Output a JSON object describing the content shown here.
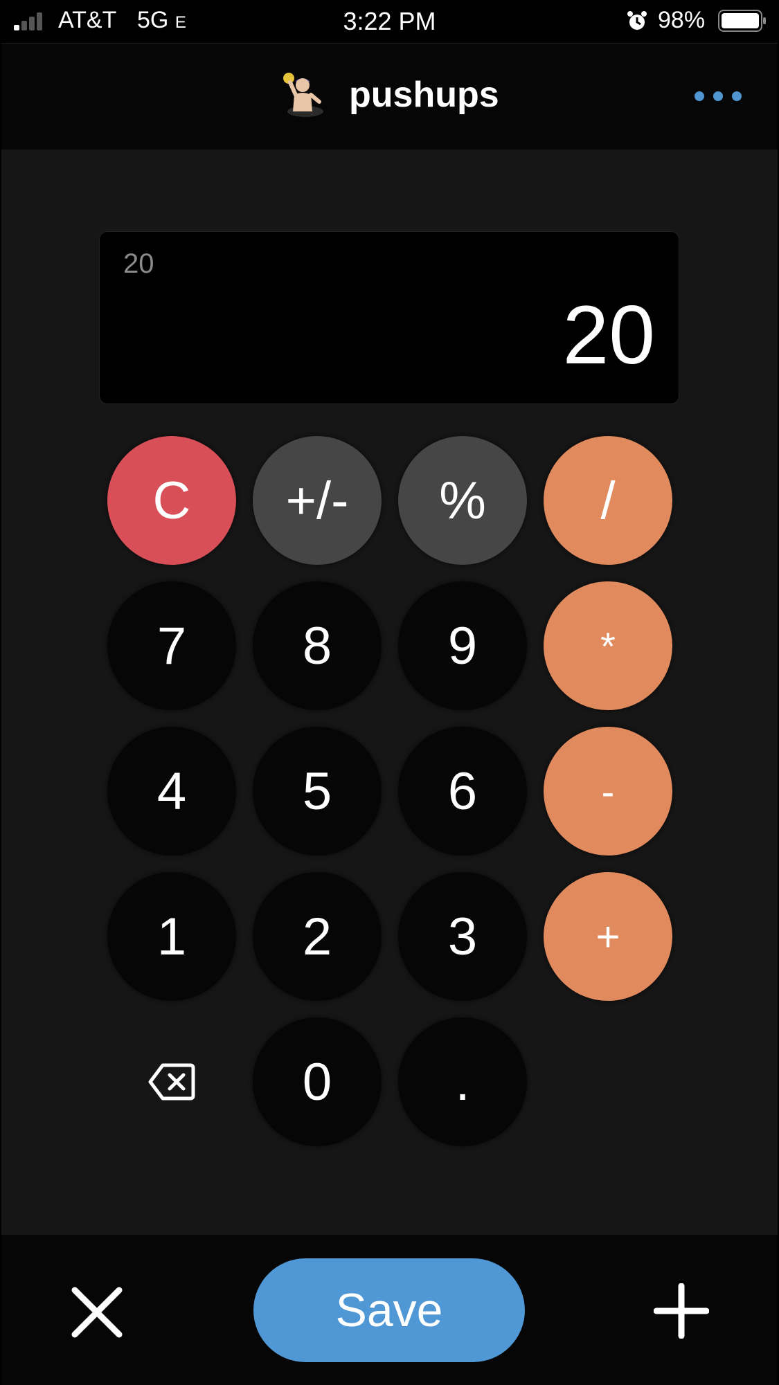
{
  "status_bar": {
    "carrier": "AT&T",
    "network": "5G",
    "network_suffix": "E",
    "time": "3:22 PM",
    "battery": "98%"
  },
  "header": {
    "title": "pushups",
    "avatar_icon": "water-polo-icon",
    "menu_icon": "more-horizontal-icon",
    "accent_color": "#4f96d3"
  },
  "display": {
    "expression": "20",
    "result": "20"
  },
  "keypad": {
    "clear": "C",
    "sign": "+/-",
    "percent": "%",
    "divide": "/",
    "seven": "7",
    "eight": "8",
    "nine": "9",
    "multiply": "*",
    "four": "4",
    "five": "5",
    "six": "6",
    "subtract": "-",
    "one": "1",
    "two": "2",
    "three": "3",
    "add": "+",
    "backspace_icon": "backspace-icon",
    "zero": "0",
    "decimal": "."
  },
  "bottom_bar": {
    "save_label": "Save",
    "close_icon": "close-icon",
    "add_icon": "plus-icon"
  },
  "colors": {
    "clear": "#d84f57",
    "function": "#464646",
    "operator": "#e08a5e",
    "digit": "#060606",
    "save": "#4f98d5"
  }
}
